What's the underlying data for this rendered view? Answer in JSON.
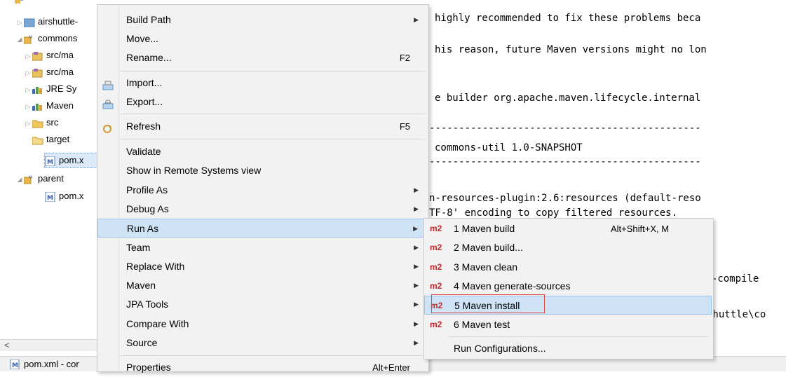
{
  "explorer": {
    "items": [
      {
        "label": "airshuttle-",
        "arrow": "▷"
      },
      {
        "label": "commons",
        "arrow": "◢"
      },
      {
        "label": "src/ma",
        "arrow": "▷"
      },
      {
        "label": "src/ma",
        "arrow": "▷"
      },
      {
        "label": "JRE Sy",
        "arrow": "▷"
      },
      {
        "label": "Maven",
        "arrow": "▷"
      },
      {
        "label": "src",
        "arrow": "▷"
      },
      {
        "label": "target",
        "arrow": ""
      },
      {
        "label": "pom.x",
        "arrow": ""
      },
      {
        "label": "parent",
        "arrow": "◢"
      },
      {
        "label": "pom.x",
        "arrow": ""
      }
    ],
    "scroll_left": "<"
  },
  "status_bar": {
    "text": "pom.xml - cor"
  },
  "console": {
    "lines": [
      "highly recommended to fix these problems beca",
      "his reason, future Maven versions might no lon",
      "e builder org.apache.maven.lifecycle.internal",
      "----------------------------------------------",
      "commons-util 1.0-SNAPSHOT",
      "----------------------------------------------",
      "n-resources-plugin:2.6:resources (default-reso",
      "TF-8' encoding to copy filtered resources.",
      "lt-compile",
      "shuttle\\co"
    ]
  },
  "context_menu": {
    "items": [
      {
        "label": "Build Path",
        "accel": "",
        "submenu": true
      },
      {
        "label": "Move...",
        "accel": "",
        "submenu": false
      },
      {
        "label": "Rename...",
        "accel": "F2",
        "submenu": false
      },
      {
        "label": "Import...",
        "accel": "",
        "submenu": false,
        "icon": "import-icon"
      },
      {
        "label": "Export...",
        "accel": "",
        "submenu": false,
        "icon": "export-icon"
      },
      {
        "label": "Refresh",
        "accel": "F5",
        "submenu": false,
        "icon": "refresh-icon"
      },
      {
        "label": "Validate",
        "accel": "",
        "submenu": false
      },
      {
        "label": "Show in Remote Systems view",
        "accel": "",
        "submenu": false
      },
      {
        "label": "Profile As",
        "accel": "",
        "submenu": true
      },
      {
        "label": "Debug As",
        "accel": "",
        "submenu": true
      },
      {
        "label": "Run As",
        "accel": "",
        "submenu": true,
        "highlighted": true
      },
      {
        "label": "Team",
        "accel": "",
        "submenu": true
      },
      {
        "label": "Replace With",
        "accel": "",
        "submenu": true
      },
      {
        "label": "Maven",
        "accel": "",
        "submenu": true
      },
      {
        "label": "JPA Tools",
        "accel": "",
        "submenu": true
      },
      {
        "label": "Compare With",
        "accel": "",
        "submenu": true
      },
      {
        "label": "Source",
        "accel": "",
        "submenu": true
      },
      {
        "label": "Properties",
        "accel": "Alt+Enter",
        "submenu": false
      }
    ],
    "submenu_arrow": "▶"
  },
  "run_as_submenu": {
    "badge": "m2",
    "items": [
      {
        "label": "1 Maven build",
        "accel": "Alt+Shift+X, M",
        "badge": true
      },
      {
        "label": "2 Maven build...",
        "accel": "",
        "badge": true
      },
      {
        "label": "3 Maven clean",
        "accel": "",
        "badge": true
      },
      {
        "label": "4 Maven generate-sources",
        "accel": "",
        "badge": true
      },
      {
        "label": "5 Maven install",
        "accel": "",
        "badge": true,
        "highlighted": true
      },
      {
        "label": "6 Maven test",
        "accel": "",
        "badge": true
      },
      {
        "label": "Run Configurations...",
        "accel": "",
        "badge": false
      }
    ]
  },
  "colors": {
    "highlight": "#cfe3f7",
    "annotation_box": "#e0443c",
    "m2_badge": "#c0282d"
  }
}
